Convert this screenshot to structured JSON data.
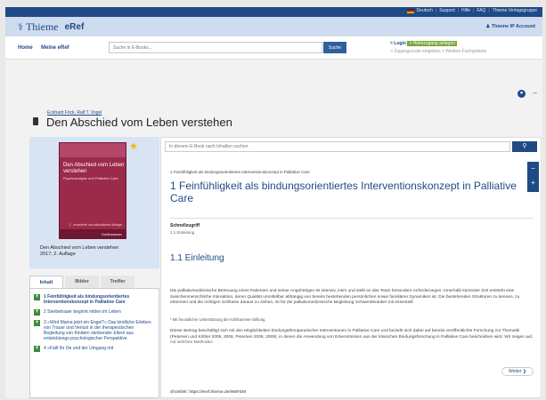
{
  "topbar": {
    "lang": "Deutsch",
    "links": [
      "Support",
      "Hilfe",
      "FAQ",
      "Thieme Verlagsgruppe"
    ]
  },
  "header": {
    "brand": "Thieme",
    "product": "eRef",
    "account": "Thieme IP Account"
  },
  "nav": {
    "home": "Home",
    "my_eref": "Meine eRef",
    "search_placeholder": "Suche in E-Books...",
    "search_button": "Suche",
    "login": "> Login",
    "heimzugang": "> Heimzugang anlegen",
    "zugangscode": "> Zugangscode eingeben",
    "fachgebiete": "> Weitere Fachgebiete"
  },
  "book": {
    "authors": "Eckhard Frick, Ralf T. Vogel",
    "title": "Den Abschied vom Leben verstehen",
    "cover_title": "Den Abschied vom Leben verstehen",
    "cover_subtitle": "Psychoanalyse und Palliative Care",
    "cover_publisher": "Kohlhammer",
    "cover_edition": "2., erweiterte und aktualisierte Auflage",
    "caption_line1": "Den Abschied vom Leben verstehen",
    "caption_line2": "2017; 2. Auflage"
  },
  "left_tabs": [
    "Inhalt",
    "Bilder",
    "Treffer"
  ],
  "toc": [
    "1 Feinfühligkeit als bindungsorientiertes Interventionskonzept in Palliative Care",
    "2 Sterbetrauer beginnt mitten im Leben",
    "3 »Wird Mama jetzt ein Engel?« Das kindliche Erleben von Trauer und Verlust in der therapeutischen Begleitung von Kindern sterbender Eltern aus entwicklungs-psychologischer Perspektive",
    "4 »Fallt ihr Oe und der Umgang mit"
  ],
  "main": {
    "search_placeholder": "In diesem E-Book nach Inhalten suchen",
    "breadcrumb": "1 Feinfühligkeit als bindungsorientiertes Interventionskonzept in Palliative Care",
    "chapter_title": "1 Feinfühligkeit als bindungsorientiertes Interventionskonzept in Palliative Care",
    "keyword_label": "Schnellzugriff",
    "keyword": "1.1 Einleitung",
    "section_title": "1.1 Einleitung",
    "paragraph1": "Die palliativmedizinische Betreuung eines Patienten und seiner Angehörigen ist intensiv, intim und stellt an das Team besondere Anforderungen. Innerhalb kürzester Zeit entsteht eine zwischenmenschliche Interaktion, deren Qualität unmittelbar abhängig von bereits bestehenden persönlichen sowie familiären Dynamiken ist. Die bestehenden Strukturen zu kennen, zu erkennen und die richtigen Schlüsse daraus zu ziehen, ist für die palliativmedizinische Begleitung Schwerstkranker mit essentiell.",
    "footnote": "* Mit freundlicher Unterstützung der Kohlhammer-Stiftung.",
    "paragraph2": "Dieser Beitrag beschäftigt sich mit den Möglichkeiten bindungstherapeutischer Interventionen in Palliative Care und bezieht sich dabei auf bereits veröffentlichte Forschung zur Thematik (Petersen und Köhler 2005, 2006, Petersen 2008, 2009), in denen die Anwendung von Erkenntnissen aus der klinischen Bindungsforschung in Palliative Care beschrieben wird. Wir zeigen auf, mit welchen Methoden",
    "next_button": "Weiter ❯",
    "shortlink": "Shortlink: https://eref.thieme.de/W6FEM"
  }
}
